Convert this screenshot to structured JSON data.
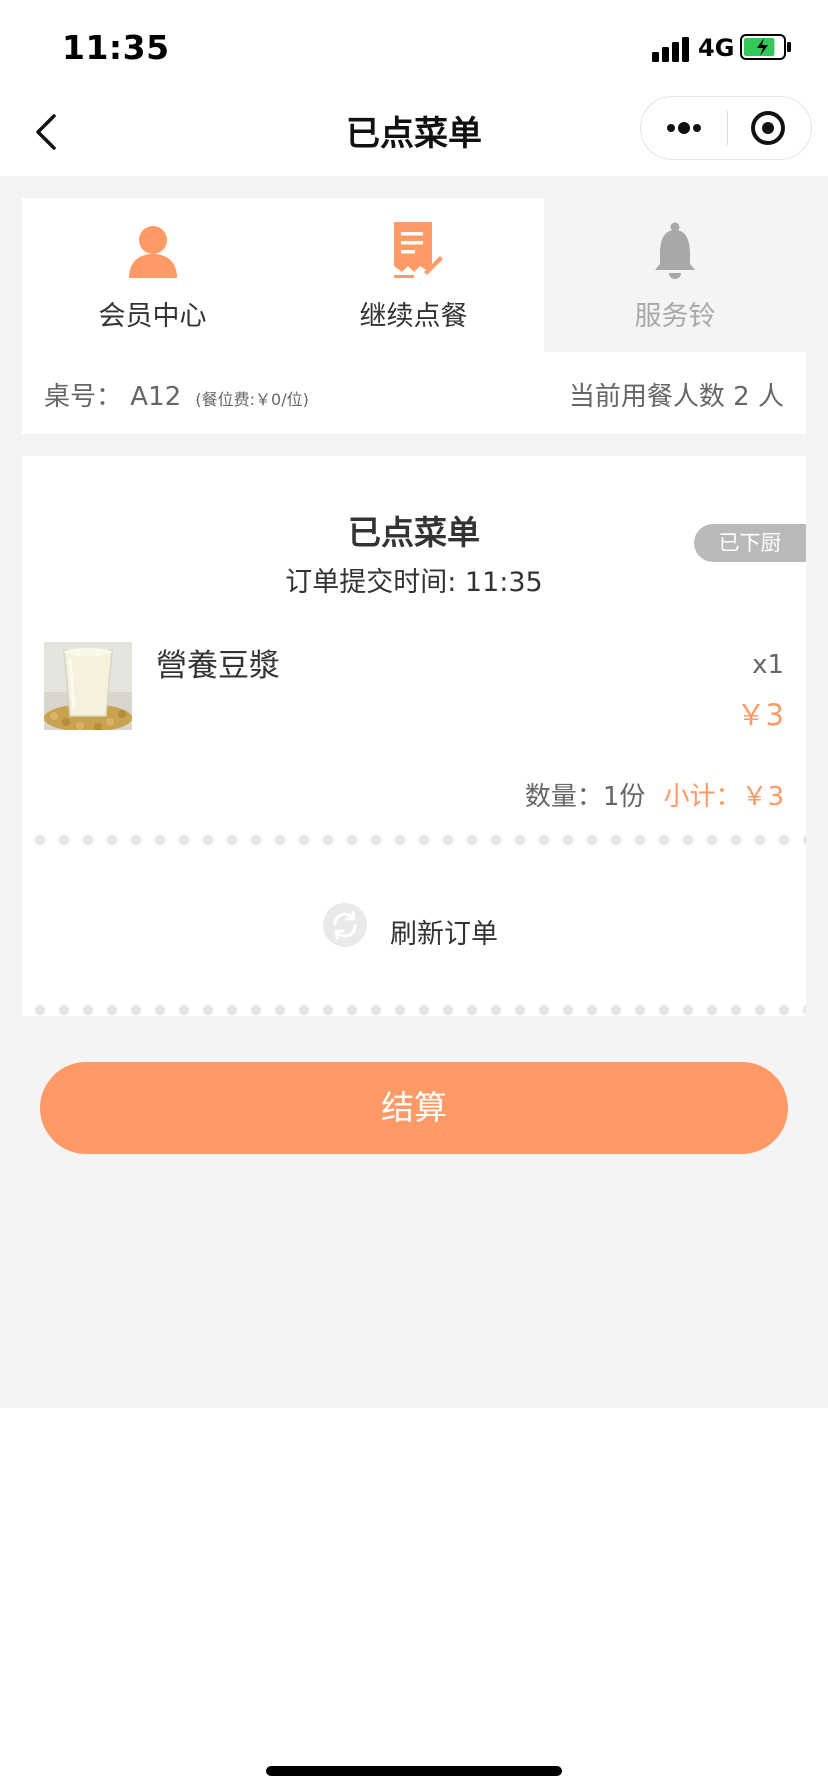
{
  "status_bar": {
    "time": "11:35",
    "network": "4G",
    "battery_level": 0.8
  },
  "nav": {
    "title": "已点菜单",
    "back_icon": "chevron-left-icon",
    "more_icon": "more-dots-icon",
    "close_icon": "target-circle-icon"
  },
  "quick_actions": {
    "member": {
      "label": "会员中心",
      "icon": "person-icon"
    },
    "order": {
      "label": "继续点餐",
      "icon": "order-list-icon"
    },
    "bell": {
      "label": "服务铃",
      "icon": "bell-icon"
    }
  },
  "table_info": {
    "table_label": "桌号：",
    "table_number": "A12",
    "seat_fee": "(餐位费:￥0/位)",
    "diners_text": "当前用餐人数 2 人"
  },
  "order": {
    "title": "已点菜单",
    "submit_time": "订单提交时间: 11:35",
    "status": "已下厨",
    "items": [
      {
        "name": "營養豆漿",
        "qty": "x1",
        "price": "￥3",
        "image_icon": "soy-milk-image"
      }
    ],
    "summary": {
      "qty_label": "数量：",
      "qty_value": "1份",
      "subtotal_label": "小计：",
      "subtotal_value": "￥3"
    },
    "refresh_label": "刷新订单",
    "refresh_icon": "refresh-icon"
  },
  "checkout": {
    "label": "结算"
  },
  "colors": {
    "accent": "#ff9966",
    "badge": "#b9b9b9",
    "background": "#f4f4f4",
    "muted": "#a8a8a8"
  }
}
